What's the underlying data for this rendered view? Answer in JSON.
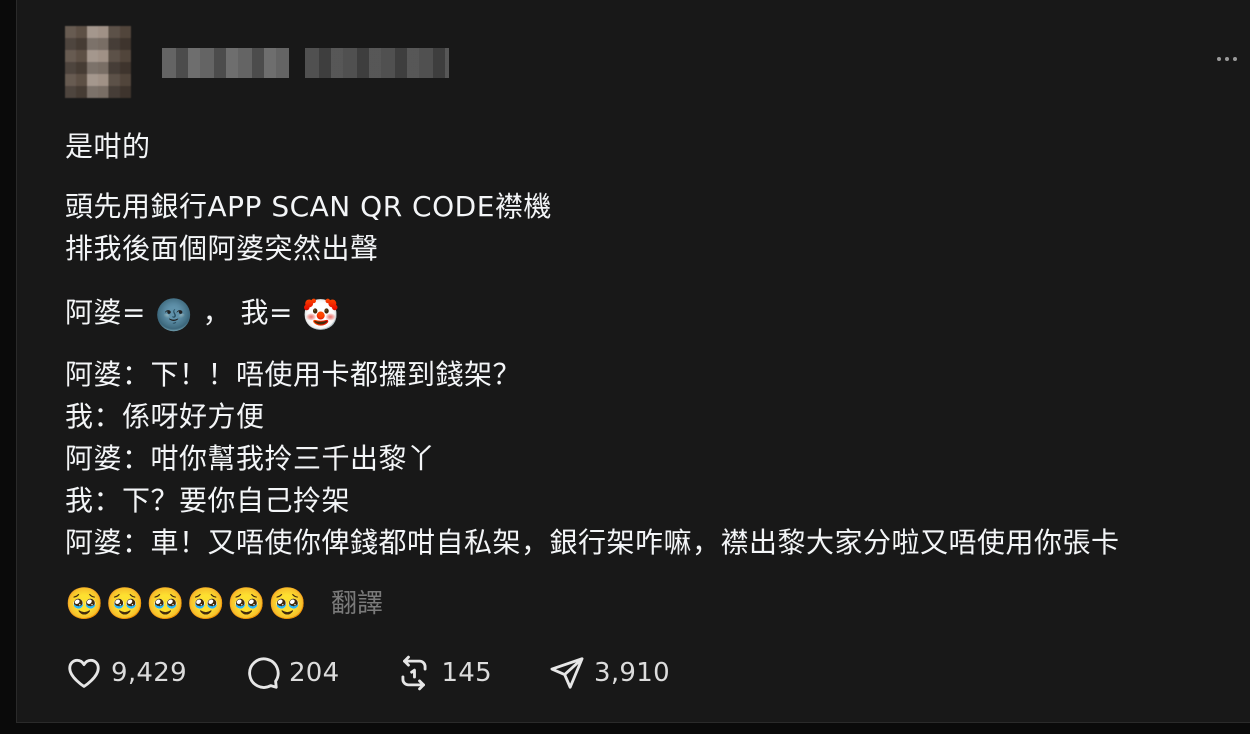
{
  "post": {
    "lines": {
      "l1": "是咁的",
      "l2": "頭先用銀行APP SCAN QR CODE襟機",
      "l3": "排我後面個阿婆突然出聲",
      "l4_a": "阿婆= ",
      "l4_emoji1": "🌚",
      "l4_b": " ， 我= ",
      "l4_emoji2": "🤡",
      "d1": "阿婆：下！！唔使用卡都攞到錢架？",
      "d2": "我：係呀好方便",
      "d3": "阿婆：咁你幫我拎三千出黎丫",
      "d4": "我：下？要你自己拎架",
      "d5": "阿婆：車！又唔使你俾錢都咁自私架，銀行架咋嘛，襟出黎大家分啦又唔使用你張卡"
    },
    "emoji_row": "🥹🥹🥹🥹🥹🥹",
    "translate_label": "翻譯"
  },
  "actions": {
    "likes": "9,429",
    "comments": "204",
    "reposts": "145",
    "shares": "3,910"
  },
  "icons": {
    "like": "heart-icon",
    "comment": "comment-bubble-icon",
    "repost": "repost-icon",
    "share": "send-icon",
    "more": "more-options-icon"
  }
}
